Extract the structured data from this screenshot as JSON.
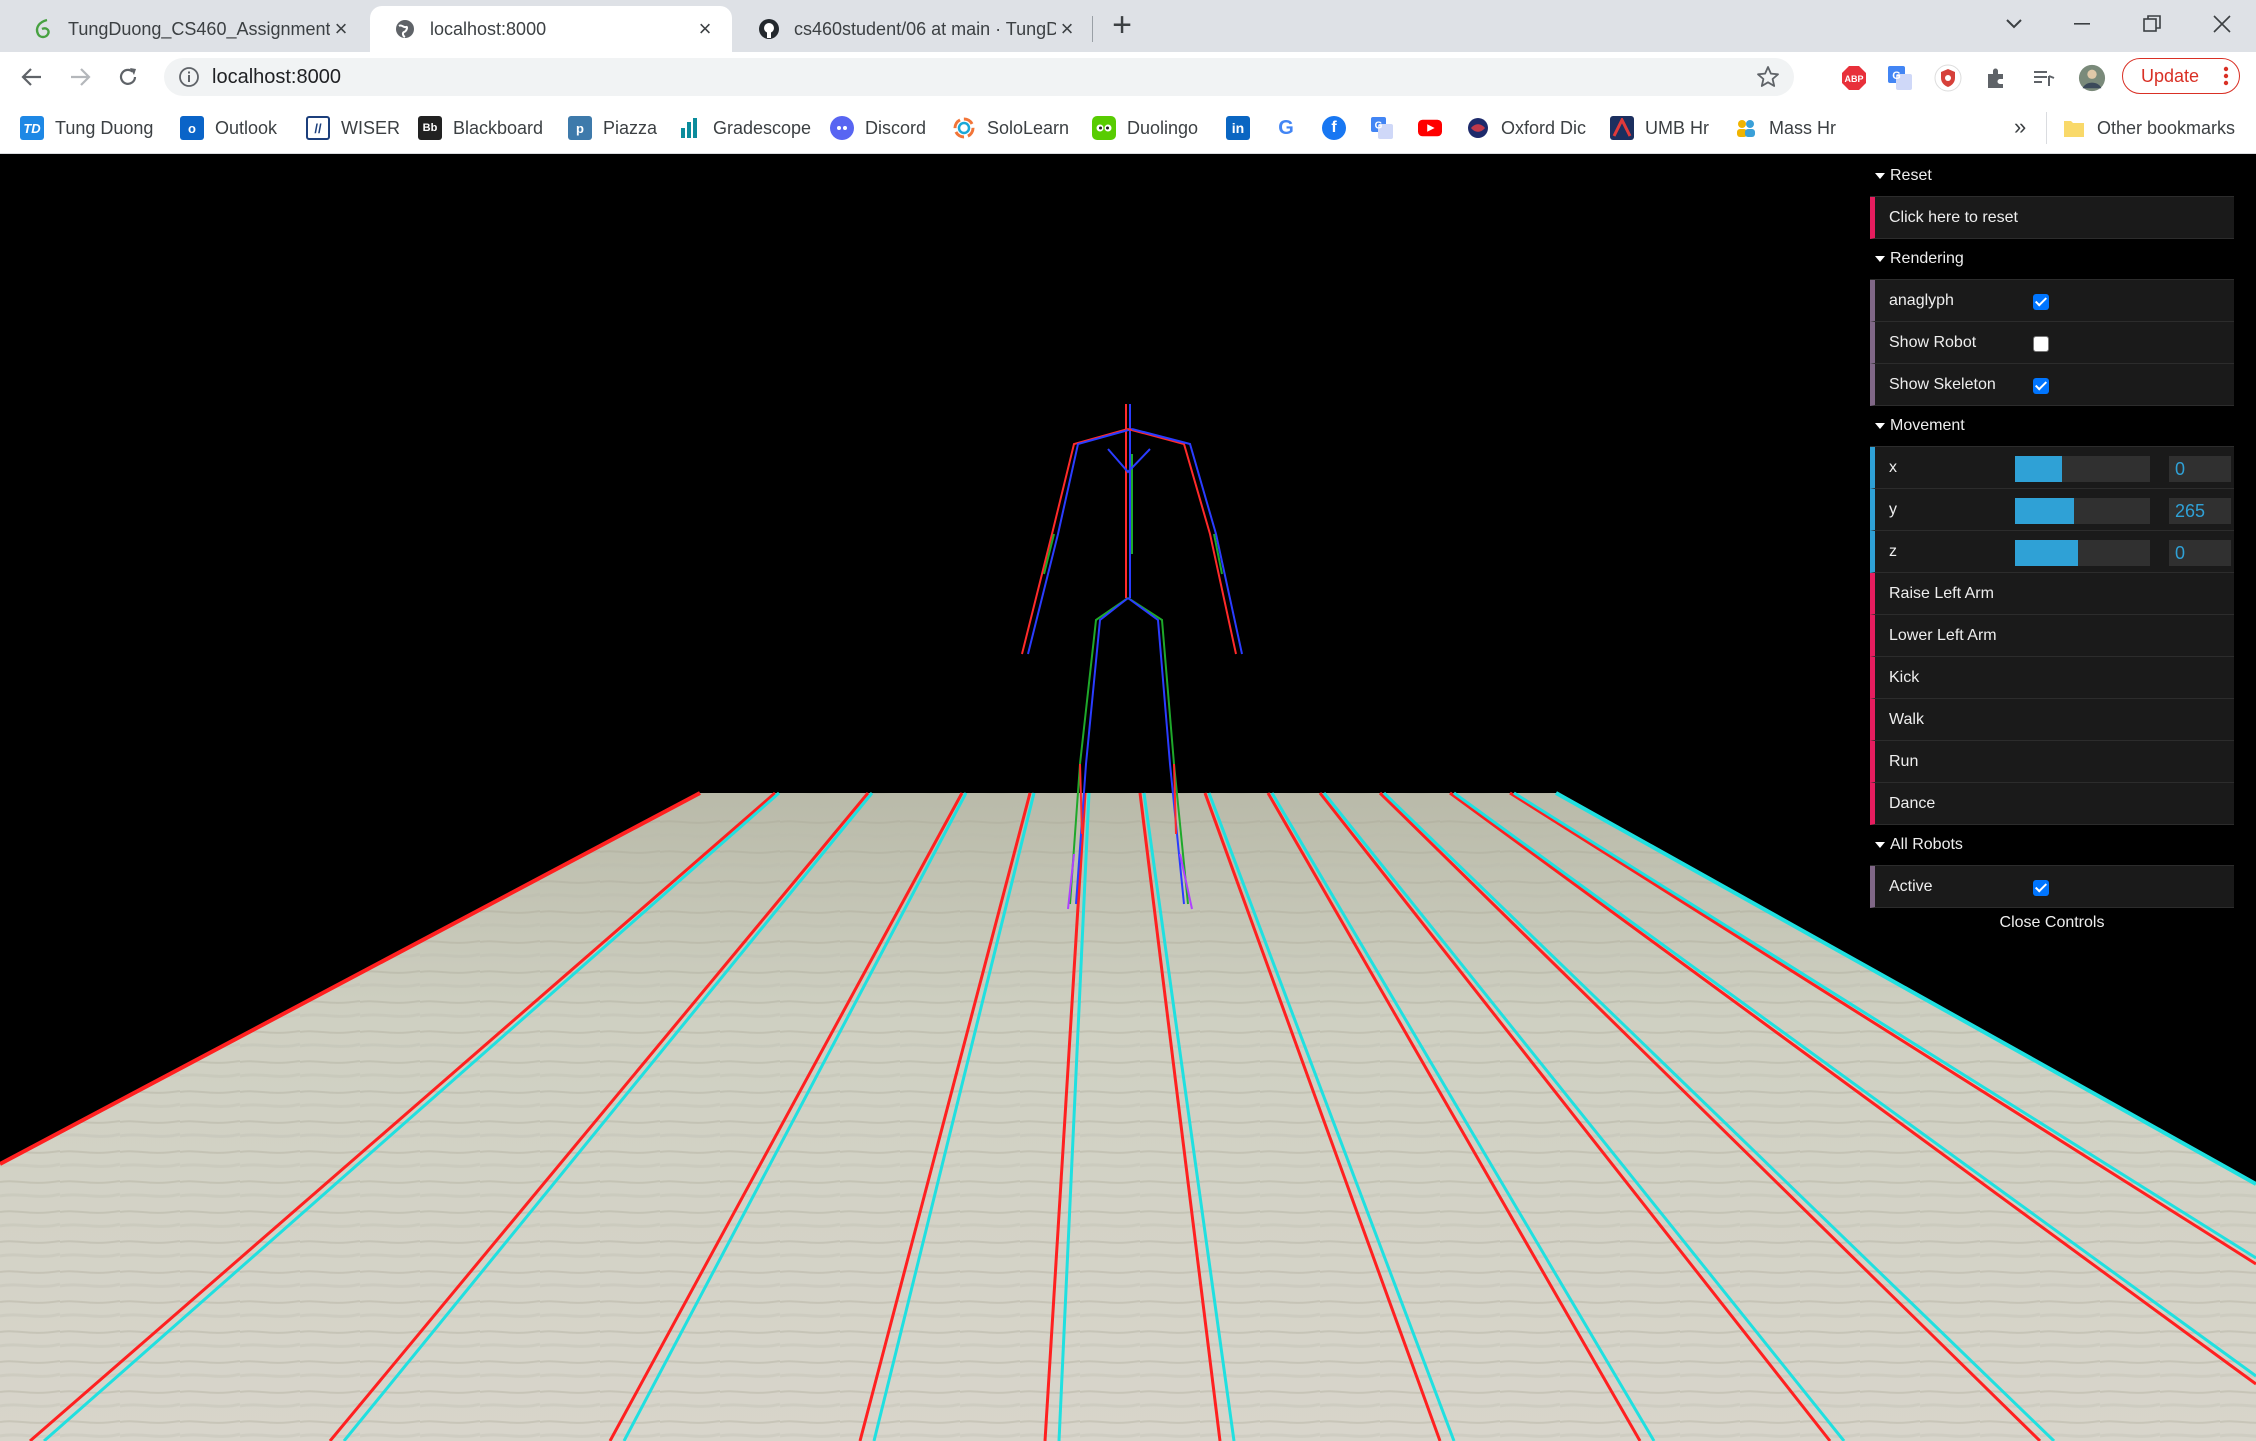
{
  "browser": {
    "tabs": [
      {
        "title": "TungDuong_CS460_Assignment_",
        "icon": "overleaf-icon",
        "active": false
      },
      {
        "title": "localhost:8000",
        "icon": "globe-icon",
        "active": true
      },
      {
        "title": "cs460student/06 at main · TungD",
        "icon": "github-icon",
        "active": false
      }
    ],
    "url": "localhost:8000",
    "update_label": "Update"
  },
  "bookmarks": [
    {
      "label": "Tung Duong",
      "icon": "td-icon"
    },
    {
      "label": "Outlook",
      "icon": "outlook-icon"
    },
    {
      "label": "WISER",
      "icon": "wiser-icon"
    },
    {
      "label": "Blackboard",
      "icon": "blackboard-icon"
    },
    {
      "label": "Piazza",
      "icon": "piazza-icon"
    },
    {
      "label": "Gradescope",
      "icon": "gradescope-icon"
    },
    {
      "label": "Discord",
      "icon": "discord-icon"
    },
    {
      "label": "SoloLearn",
      "icon": "sololearn-icon"
    },
    {
      "label": "Duolingo",
      "icon": "duolingo-icon"
    },
    {
      "label": "",
      "icon": "linkedin-icon"
    },
    {
      "label": "",
      "icon": "google-icon"
    },
    {
      "label": "",
      "icon": "facebook-icon"
    },
    {
      "label": "",
      "icon": "google-translate-icon"
    },
    {
      "label": "",
      "icon": "youtube-icon"
    },
    {
      "label": "Oxford Dic",
      "icon": "oxford-icon"
    },
    {
      "label": "UMB Hr",
      "icon": "umb-icon"
    },
    {
      "label": "Mass Hr",
      "icon": "mass-icon"
    }
  ],
  "other_bookmarks": "Other bookmarks",
  "gui": {
    "reset": {
      "folder": "Reset",
      "button": "Click here to reset"
    },
    "rendering": {
      "folder": "Rendering",
      "anaglyph": {
        "label": "anaglyph",
        "checked": true
      },
      "show_robot": {
        "label": "Show Robot",
        "checked": false
      },
      "show_skeleton": {
        "label": "Show Skeleton",
        "checked": true
      }
    },
    "movement": {
      "folder": "Movement",
      "sliders": [
        {
          "label": "x",
          "value": "0",
          "fill_fraction": 0.35
        },
        {
          "label": "y",
          "value": "265",
          "fill_fraction": 0.44
        },
        {
          "label": "z",
          "value": "0",
          "fill_fraction": 0.47
        }
      ],
      "actions": [
        "Raise Left Arm",
        "Lower Left Arm",
        "Kick",
        "Walk",
        "Run",
        "Dance"
      ]
    },
    "all_robots": {
      "folder": "All Robots",
      "active": {
        "label": "Active",
        "checked": true
      }
    },
    "close": "Close Controls"
  },
  "colors": {
    "function_accent": "#e61d5f",
    "boolean_accent": "#806787",
    "number_accent": "#2fa1d6",
    "floor_light": "#d6d3c8",
    "floor_dark": "#a9aa98",
    "anaglyph_red": "#ff2020",
    "anaglyph_cyan": "#20e0e0"
  }
}
